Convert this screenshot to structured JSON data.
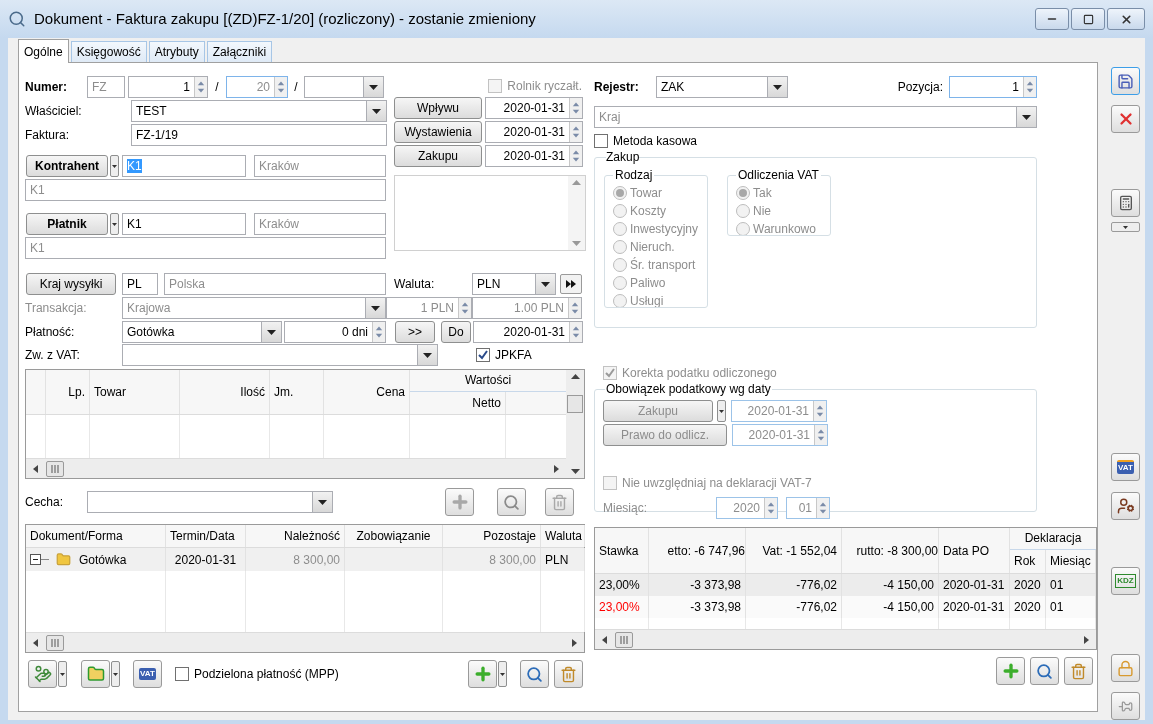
{
  "window": {
    "title": "Dokument - Faktura zakupu [(ZD)FZ-1/20] (rozliczony) - zostanie zmieniony"
  },
  "tabs": [
    {
      "label": "Ogólne",
      "selected": true
    },
    {
      "label": "Księgowość",
      "selected": false
    },
    {
      "label": "Atrybuty",
      "selected": false
    },
    {
      "label": "Załączniki",
      "selected": false
    }
  ],
  "numer": {
    "label": "Numer:",
    "prefix": {
      "value": "FZ",
      "disabled": true
    },
    "number": "1",
    "separator_1": "/",
    "year": {
      "value": "20",
      "disabled": true
    },
    "separator_2": "/"
  },
  "owner": {
    "label": "Właściciel:",
    "value": "TEST"
  },
  "invoice": {
    "label": "Faktura:",
    "value": "FZ-1/19"
  },
  "contractor": {
    "button": "Kontrahent",
    "code": {
      "value": "K1",
      "text_selected": true
    },
    "city": {
      "value": "Kraków",
      "disabled": true
    },
    "name": {
      "value": "K1",
      "disabled": true
    }
  },
  "payer": {
    "button": "Płatnik",
    "code": {
      "value": "K1",
      "text_selected": false
    },
    "city": {
      "value": "Kraków",
      "disabled": true
    },
    "name": {
      "value": "K1",
      "disabled": true
    }
  },
  "flat_rate_farmer": {
    "label": "Rolnik ryczałt.",
    "checked": false,
    "disabled": true
  },
  "dates": [
    {
      "button": "Wpływu",
      "value": "2020-01-31"
    },
    {
      "button": "Wystawienia",
      "value": "2020-01-31"
    },
    {
      "button": "Zakupu",
      "value": "2020-01-31"
    }
  ],
  "shipping": {
    "button": "Kraj wysyłki",
    "code": "PL",
    "name": {
      "value": "Polska",
      "disabled": true
    }
  },
  "currency": {
    "label": "Waluta:",
    "value": "PLN"
  },
  "transaction": {
    "label": "Transakcja:",
    "disabled": true,
    "value": "Krajowa",
    "rate": "1 PLN",
    "exchange": "1.00 PLN"
  },
  "payment": {
    "label": "Płatność:",
    "method": "Gotówka",
    "days": "0 dni",
    "more_button": ">>",
    "to_button": "Do",
    "due_date": "2020-01-31"
  },
  "vat_exemption": {
    "label": "Zw. z VAT:"
  },
  "jpkfa": {
    "label": "JPKFA",
    "checked": true,
    "disabled": false
  },
  "items_table": {
    "columns": [
      "Lp.",
      "Towar",
      "Ilość",
      "Jm.",
      "Cena"
    ],
    "group": {
      "label": "Wartości",
      "columns": [
        "Netto"
      ]
    }
  },
  "feature": {
    "label": "Cecha:"
  },
  "payments_table": {
    "columns": [
      "Dokument/Forma",
      "Termin/Data",
      "Należność",
      "Zobowiązanie",
      "Pozostaje",
      "Waluta"
    ],
    "rows": [
      {
        "expanded": true,
        "amounts_disabled": true,
        "form": "Gotówka",
        "date": "2020-01-31",
        "receivable": "8 300,00",
        "remaining": "8 300,00",
        "currency": "PLN"
      }
    ]
  },
  "split_payment": {
    "label": "Podzielona płatność (MPP)",
    "checked": false,
    "disabled": false
  },
  "vat_badge": "VAT",
  "register": {
    "label": "Rejestr:",
    "value": "ZAK"
  },
  "position": {
    "label": "Pozycja:",
    "value": "1"
  },
  "country_type": {
    "value": "Kraj",
    "disabled": true
  },
  "cash_method": {
    "label": "Metoda kasowa",
    "checked": false,
    "disabled": false
  },
  "purchase": {
    "title": "Zakup",
    "kind_group": {
      "title": "Rodzaj",
      "disabled": true,
      "options": [
        {
          "label": "Towar",
          "selected": true
        },
        {
          "label": "Koszty",
          "selected": false
        },
        {
          "label": "Inwestycyjny",
          "selected": false
        },
        {
          "label": "Nieruch.",
          "selected": false
        },
        {
          "label": "Śr. transport",
          "selected": false
        },
        {
          "label": "Paliwo",
          "selected": false
        },
        {
          "label": "Usługi",
          "selected": false
        }
      ]
    },
    "vat_deduction": {
      "title": "Odliczenia VAT",
      "disabled": true,
      "options": [
        {
          "label": "Tak",
          "selected": true
        },
        {
          "label": "Nie",
          "selected": false
        },
        {
          "label": "Warunkowo",
          "selected": false
        }
      ]
    }
  },
  "correction": {
    "label": "Korekta podatku odliczonego",
    "checked": true,
    "disabled": true
  },
  "tax_obligation": {
    "title": "Obowiązek podatkowy wg daty",
    "disabled": true,
    "dates": [
      {
        "button": "Zakupu",
        "value": "2020-01-31",
        "has_menu": true
      },
      {
        "button": "Prawo do odlicz.",
        "value": "2020-01-31",
        "has_menu": false
      }
    ],
    "exclude": {
      "label": "Nie uwzględniaj na deklaracji VAT-7",
      "checked": false,
      "disabled": true
    },
    "month": {
      "label": "Miesiąc:",
      "year": "2020",
      "month": "01"
    }
  },
  "vat_table": {
    "columns": [
      "Stawka",
      "etto: -6 747,96",
      "Vat: -1 552,04",
      "rutto: -8 300,00",
      "Data PO"
    ],
    "group": {
      "label": "Deklaracja",
      "columns": [
        "Rok",
        "Miesiąc"
      ]
    },
    "rows": [
      {
        "selected": true,
        "color": "#000000",
        "cells": [
          "23,00%",
          "-3 373,98",
          "-776,02",
          "-4 150,00",
          "2020-01-31",
          "2020",
          "01"
        ]
      },
      {
        "selected": false,
        "color": "#ff0000",
        "cells": [
          "23,00%",
          "-3 373,98",
          "-776,02",
          "-4 150,00",
          "2020-01-31",
          "2020",
          "01"
        ]
      }
    ]
  },
  "side_toolbar": {
    "vat_icon_text": "VAT",
    "kdz_icon_text": "KDZ"
  }
}
